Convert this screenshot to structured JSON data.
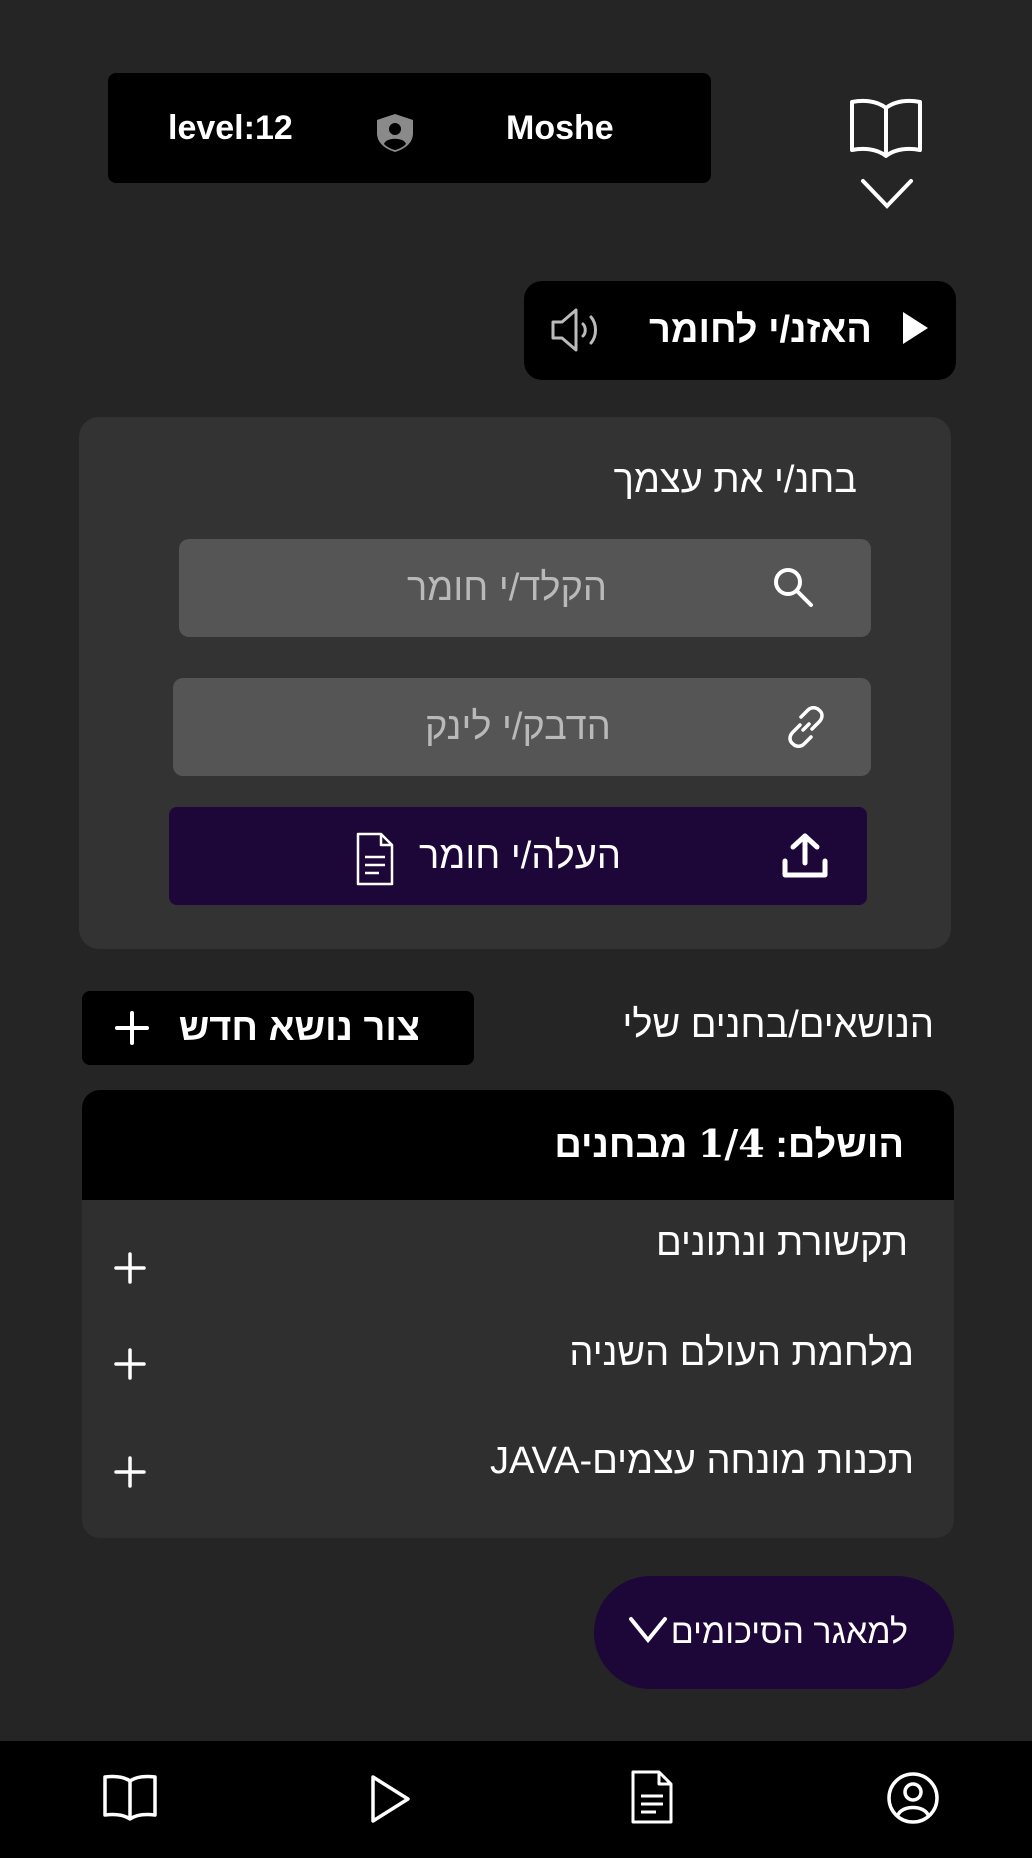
{
  "profile": {
    "level_text": "level:12",
    "username": "Moshe"
  },
  "listen": {
    "label": "האזנ/י לחומר"
  },
  "test_card": {
    "title": "בחנ/י את  עצמך",
    "search_placeholder": "הקלד/י חומר",
    "link_placeholder": "הדבק/י לינק",
    "upload_label": "העלה/י חומר"
  },
  "topics": {
    "heading": "הנושאים/בחנים שלי",
    "create_label": "צור נושא חדש",
    "completed_prefix": "הושלם:",
    "completed_fraction": "1/4",
    "completed_suffix": "מבחנים",
    "items": [
      {
        "label": "תקשורת ונתונים"
      },
      {
        "label": "מלחמת העולם השניה"
      },
      {
        "label": "תכנות מונחה עצמים-JAVA"
      }
    ]
  },
  "summaries": {
    "label": "למאגר הסיכומים"
  },
  "colors": {
    "background": "#252525",
    "card": "#333333",
    "field": "#555555",
    "accent_purple": "#1d0638",
    "black": "#000000"
  },
  "icons": {
    "header": [
      "shield-user-icon",
      "book-icon",
      "chevron-down-icon"
    ],
    "listen": [
      "speaker-icon",
      "play-icon"
    ],
    "fields": [
      "search-icon",
      "link-icon",
      "upload-icon",
      "document-icon"
    ],
    "nav": [
      "book-icon",
      "play-icon",
      "document-icon",
      "user-icon"
    ]
  }
}
